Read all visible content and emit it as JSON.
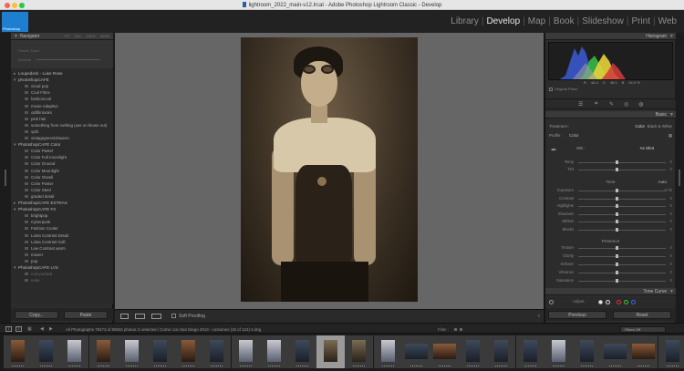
{
  "window": {
    "title": "lightroom_2022_main-v12.lrcat - Adobe Photoshop Lightroom Classic - Develop"
  },
  "identity": {
    "logo_text": "Photoshop"
  },
  "modules": [
    {
      "label": "Library",
      "active": false
    },
    {
      "label": "Develop",
      "active": true
    },
    {
      "label": "Map",
      "active": false
    },
    {
      "label": "Book",
      "active": false
    },
    {
      "label": "Slideshow",
      "active": false
    },
    {
      "label": "Print",
      "active": false
    },
    {
      "label": "Web",
      "active": false
    }
  ],
  "navigator": {
    "title": "Navigator",
    "zoom": [
      "FIT",
      "FILL",
      "100%",
      "400%"
    ],
    "preset_label": "Preset: None",
    "amount_label": "Amount"
  },
  "presets": {
    "folders": [
      {
        "label": "Loupedeck - Luke Rose",
        "expanded": false
      },
      {
        "label": "photoshopCAFE",
        "expanded": true,
        "items": [
          "cloud pop",
          "Cool Films",
          "fashioncool",
          "moxie Adaptive",
          "oldfilmlooks",
          "pink hair",
          "something from nothing (use on blown out)",
          "split",
          "vintagegreenishwarm"
        ]
      },
      {
        "label": "PhotoshopCAFE Color",
        "expanded": true,
        "items": [
          "Color Pastel",
          "Color Full moonlight",
          "Color Ground",
          "Color Moonlight",
          "Color Orwell",
          "Color Poster",
          "Color Steel",
          "graded detail"
        ]
      },
      {
        "label": "PhotoshopCAFE EXTRAS",
        "expanded": false
      },
      {
        "label": "PhotoshopCAFE FX",
        "expanded": true,
        "items": [
          "brightpop",
          "Cyberpunk",
          "Fashion Cooler",
          "Lotsa Contrast Detail",
          "Lotsa Contrast Soft",
          "Low Contrast warm",
          "moxier",
          "pop"
        ]
      },
      {
        "label": "PhotoshopCAFE LVS",
        "expanded": true,
        "items": [
          "cool portrait",
          "nolia"
        ]
      }
    ]
  },
  "left_buttons": {
    "copy": "Copy...",
    "paste": "Paste"
  },
  "toolbar": {
    "soft_proofing": "Soft Proofing"
  },
  "histogram": {
    "title": "Histogram",
    "r_label": "R",
    "r_value": "48.4",
    "g_label": "G",
    "g_value": "45.0",
    "b_label": "B",
    "b_value": "34.9 %",
    "original_photo": "Original Photo"
  },
  "basic": {
    "title": "Basic",
    "treatment_label": "Treatment :",
    "treatment_color": "Color",
    "treatment_bw": "Black & White",
    "profile_label": "Profile :",
    "profile_value": "Color",
    "wb_label": "WB :",
    "wb_value": "As Shot",
    "wb_sliders": [
      {
        "label": "Temp",
        "value": "0"
      },
      {
        "label": "Tint",
        "value": "0"
      }
    ],
    "tone_title": "Tone",
    "tone_auto": "Auto",
    "tone_sliders": [
      {
        "label": "Exposure",
        "value": "0.00"
      },
      {
        "label": "Contrast",
        "value": "0"
      },
      {
        "label": "Highlights",
        "value": "0"
      },
      {
        "label": "Shadows",
        "value": "0"
      },
      {
        "label": "Whites",
        "value": "0"
      },
      {
        "label": "Blacks",
        "value": "0"
      }
    ],
    "presence_title": "Presence",
    "presence_sliders": [
      {
        "label": "Texture",
        "value": "0"
      },
      {
        "label": "Clarity",
        "value": "0"
      },
      {
        "label": "Dehaze",
        "value": "0"
      },
      {
        "label": "Vibrance",
        "value": "0"
      },
      {
        "label": "Saturation",
        "value": "0"
      }
    ]
  },
  "tone_curve": {
    "title": "Tone Curve",
    "adjust_label": "Adjust :"
  },
  "right_buttons": {
    "previous": "Previous",
    "reset": "Reset"
  },
  "filmstrip_bar": {
    "box1": "1",
    "box2": "2",
    "source": "All Photographs   79473 of 80934 photos /1 selected / Comic con San Diego 2013 - costumes (15 of 122)-2.dng",
    "filter_label": "Filter :",
    "filter_value": "Filters Off"
  },
  "filmstrip": {
    "thumbs": [
      {
        "orient": "portrait",
        "tone": "warm"
      },
      {
        "orient": "portrait",
        "tone": "cool"
      },
      {
        "orient": "portrait",
        "tone": "light"
      },
      {
        "orient": "portrait",
        "tone": "warm"
      },
      {
        "orient": "portrait",
        "tone": "light"
      },
      {
        "orient": "portrait",
        "tone": "cool"
      },
      {
        "orient": "portrait",
        "tone": "warm"
      },
      {
        "orient": "portrait",
        "tone": "cool"
      },
      {
        "orient": "portrait",
        "tone": "light"
      },
      {
        "orient": "portrait",
        "tone": "light"
      },
      {
        "orient": "portrait",
        "tone": "cool"
      },
      {
        "orient": "portrait",
        "tone": "sepia",
        "selected": true
      },
      {
        "orient": "portrait",
        "tone": "sepia"
      },
      {
        "orient": "portrait",
        "tone": "light"
      },
      {
        "orient": "landscape",
        "tone": "cool"
      },
      {
        "orient": "landscape",
        "tone": "warm"
      },
      {
        "orient": "portrait",
        "tone": "cool"
      },
      {
        "orient": "portrait",
        "tone": "cool"
      },
      {
        "orient": "portrait",
        "tone": "cool"
      },
      {
        "orient": "portrait",
        "tone": "light"
      },
      {
        "orient": "portrait",
        "tone": "cool"
      },
      {
        "orient": "landscape",
        "tone": "cool"
      },
      {
        "orient": "landscape",
        "tone": "warm"
      },
      {
        "orient": "portrait",
        "tone": "cool"
      }
    ]
  }
}
